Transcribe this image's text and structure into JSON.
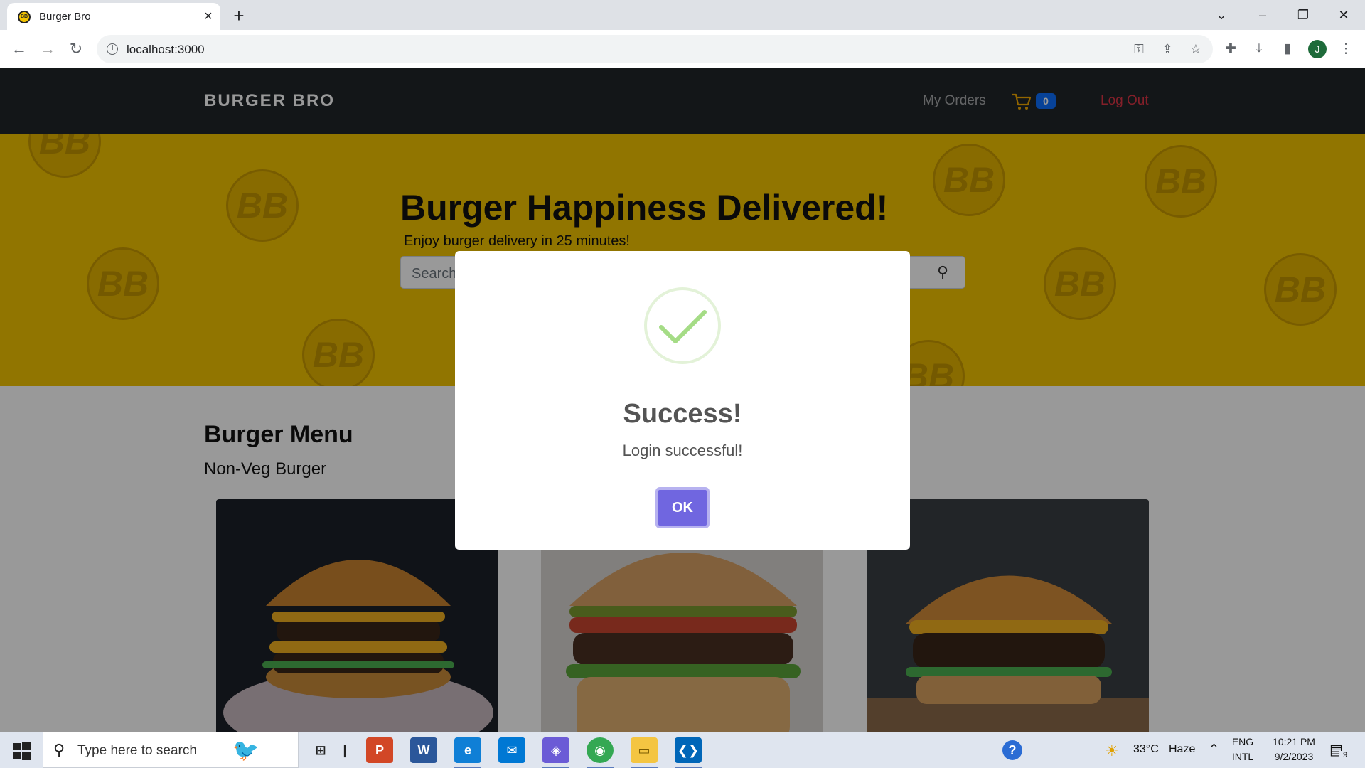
{
  "browser": {
    "tab_title": "Burger Bro",
    "url": "localhost:3000",
    "favicon_text": "BB"
  },
  "navbar": {
    "brand": "BURGER BRO",
    "my_orders": "My Orders",
    "cart_count": "0",
    "logout": "Log Out"
  },
  "hero": {
    "title": "Burger Happiness Delivered!",
    "subtitle": "Enjoy burger delivery in 25 minutes!",
    "search_placeholder": "Search",
    "bg_color": "#f2c300",
    "mark_text": "BB"
  },
  "menu": {
    "title": "Burger Menu",
    "category": "Non-Veg Burger"
  },
  "modal": {
    "title": "Success!",
    "message": "Login successful!",
    "ok_label": "OK",
    "button_color": "#7066e0"
  },
  "taskbar": {
    "search_text": "Type here to search",
    "weather_temp": "33°C",
    "weather_label": "Haze",
    "lang_top": "ENG",
    "lang_bottom": "INTL",
    "time": "10:21 PM",
    "date": "9/2/2023",
    "notification_count": "9"
  }
}
